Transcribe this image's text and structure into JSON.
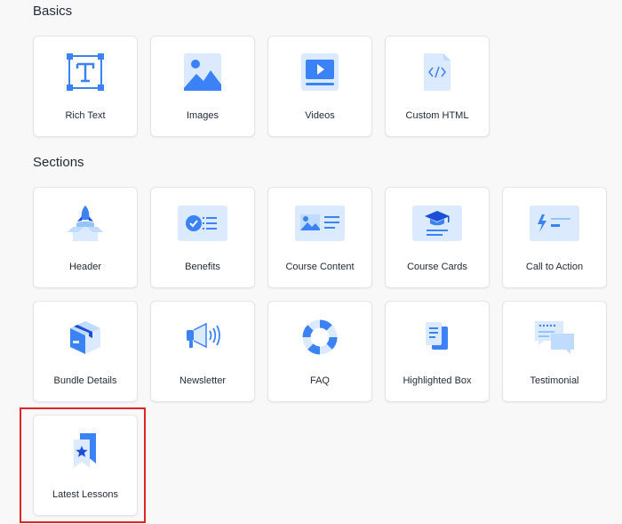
{
  "sections": {
    "basics_title": "Basics",
    "sections_title": "Sections"
  },
  "tiles": {
    "rich_text": "Rich Text",
    "images": "Images",
    "videos": "Videos",
    "custom_html": "Custom HTML",
    "header": "Header",
    "benefits": "Benefits",
    "course_content": "Course Content",
    "course_cards": "Course Cards",
    "call_to_action": "Call to Action",
    "bundle_details": "Bundle Details",
    "newsletter": "Newsletter",
    "faq": "FAQ",
    "highlighted_box": "Highlighted Box",
    "testimonial": "Testimonial",
    "latest_lessons": "Latest Lessons"
  },
  "colors": {
    "accent": "#3b82f6",
    "accent_dark": "#1d4ed8",
    "accent_light": "#dbeafe",
    "highlight": "#e02424"
  }
}
